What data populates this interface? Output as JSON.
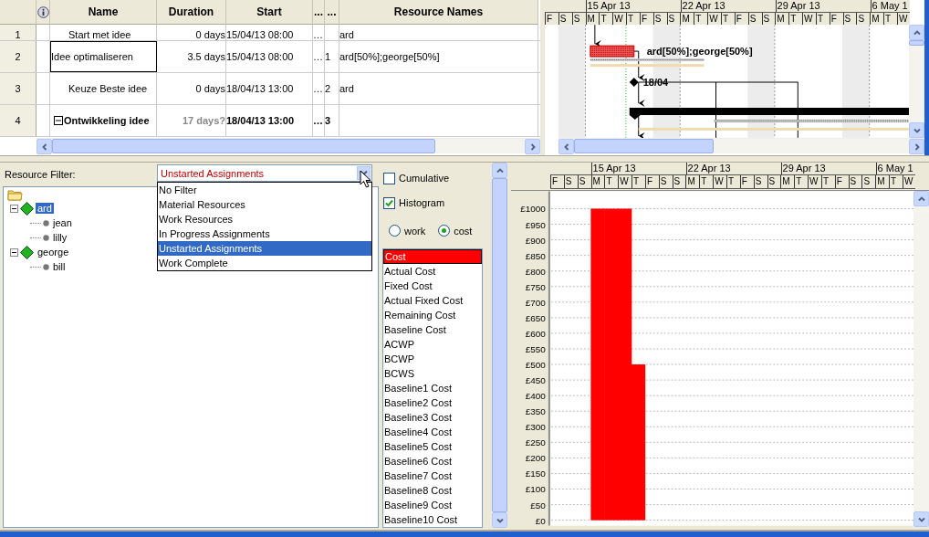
{
  "grid": {
    "columns": [
      "Name",
      "Duration",
      "Start",
      "...",
      "...",
      "Resource Names"
    ],
    "rows": [
      {
        "number": "1",
        "name": "Start met idee",
        "duration": "0 days",
        "start": "15/04/13 08:00",
        "col_5": "…",
        "resources": "ard",
        "kind": "task",
        "selected": false
      },
      {
        "number": "2",
        "name": "Idee optimaliseren",
        "duration": "3.5 days",
        "start": "15/04/13 08:00",
        "col_5": "…",
        "col_6": "1",
        "resources": "ard[50%];george[50%]",
        "kind": "task",
        "selected": true
      },
      {
        "number": "3",
        "name": "Keuze Beste idee",
        "duration": "0 days",
        "start": "18/04/13 13:00",
        "col_5": "…",
        "col_6": "2",
        "resources": "ard",
        "kind": "task",
        "selected": false
      },
      {
        "number": "4",
        "name": "Ontwikkeling idee",
        "duration": "17 days?",
        "start": "18/04/13 13:00",
        "col_5": "…",
        "col_6": "3",
        "kind": "summary",
        "expanded": true,
        "selected": false
      }
    ]
  },
  "gantt": {
    "weeks": [
      "15 Apr 13",
      "22 Apr 13",
      "29 Apr 13",
      "6 May 1"
    ],
    "days": [
      "F",
      "S",
      "S",
      "M",
      "T",
      "W",
      "T",
      "F",
      "S",
      "S",
      "M",
      "T",
      "W",
      "T",
      "F",
      "S",
      "S",
      "M",
      "T",
      "W",
      "T",
      "F",
      "S",
      "S",
      "M",
      "T",
      "W"
    ],
    "bars": [
      {
        "kind": "task",
        "label": "ard[50%];george[50%]"
      },
      {
        "kind": "milestone",
        "label": "18/04"
      },
      {
        "kind": "summary"
      }
    ]
  },
  "resource_filter": {
    "label": "Resource Filter:",
    "value": "Unstarted Assignments",
    "expanded": true,
    "options": [
      {
        "label": "No Filter",
        "selected": false
      },
      {
        "label": "Material Resources",
        "selected": false
      },
      {
        "label": "Work Resources",
        "selected": false
      },
      {
        "label": "In Progress Assignments",
        "selected": false
      },
      {
        "label": "Unstarted Assignments",
        "selected": true
      },
      {
        "label": "Work Complete",
        "selected": false
      }
    ]
  },
  "resource_tree": [
    {
      "label": "ard",
      "selected": true,
      "expanded": true,
      "children": [
        {
          "label": "jean",
          "selected": false
        },
        {
          "label": "lilly",
          "selected": false
        }
      ]
    },
    {
      "label": "george",
      "selected": false,
      "expanded": true,
      "children": [
        {
          "label": "bill",
          "selected": false
        }
      ]
    }
  ],
  "options": {
    "checkboxes": [
      {
        "label": "Cumulative",
        "checked": false
      },
      {
        "label": "Histogram",
        "checked": true
      }
    ],
    "radios": [
      {
        "label": "work",
        "selected": false
      },
      {
        "label": "cost",
        "selected": true
      }
    ],
    "fields": [
      {
        "label": "Cost",
        "selected": true
      },
      {
        "label": "Actual Cost",
        "selected": false
      },
      {
        "label": "Fixed Cost",
        "selected": false
      },
      {
        "label": "Actual Fixed Cost",
        "selected": false
      },
      {
        "label": "Remaining Cost",
        "selected": false
      },
      {
        "label": "Baseline Cost",
        "selected": false
      },
      {
        "label": "ACWP",
        "selected": false
      },
      {
        "label": "BCWP",
        "selected": false
      },
      {
        "label": "BCWS",
        "selected": false
      },
      {
        "label": "Baseline1 Cost",
        "selected": false
      },
      {
        "label": "Baseline2 Cost",
        "selected": false
      },
      {
        "label": "Baseline3 Cost",
        "selected": false
      },
      {
        "label": "Baseline4 Cost",
        "selected": false
      },
      {
        "label": "Baseline5 Cost",
        "selected": false
      },
      {
        "label": "Baseline6 Cost",
        "selected": false
      },
      {
        "label": "Baseline7 Cost",
        "selected": false
      },
      {
        "label": "Baseline8 Cost",
        "selected": false
      },
      {
        "label": "Baseline9 Cost",
        "selected": false
      },
      {
        "label": "Baseline10 Cost",
        "selected": false
      }
    ]
  },
  "histogram": {
    "weeks": [
      "15 Apr 13",
      "22 Apr 13",
      "29 Apr 13",
      "6 May 1"
    ],
    "chart_data": {
      "type": "bar",
      "categories": [
        "F",
        "S",
        "S",
        "M",
        "T",
        "W",
        "T",
        "F",
        "S",
        "S",
        "M",
        "T",
        "W",
        "T",
        "F",
        "S",
        "S",
        "M",
        "T",
        "W",
        "T",
        "F",
        "S",
        "S",
        "M",
        "T",
        "W"
      ],
      "values": [
        0,
        0,
        0,
        1000,
        1000,
        1000,
        500,
        0,
        0,
        0,
        0,
        0,
        0,
        0,
        0,
        0,
        0,
        0,
        0,
        0,
        0,
        0,
        0,
        0,
        0,
        0,
        0
      ],
      "ylim": [
        0,
        1050
      ],
      "grid": true,
      "yticks": [
        {
          "value": 0,
          "label": "£0"
        },
        {
          "value": 50,
          "label": "£50"
        },
        {
          "value": 100,
          "label": "£100"
        },
        {
          "value": 150,
          "label": "£150"
        },
        {
          "value": 200,
          "label": "£200"
        },
        {
          "value": 250,
          "label": "£250"
        },
        {
          "value": 300,
          "label": "£300"
        },
        {
          "value": 350,
          "label": "£350"
        },
        {
          "value": 400,
          "label": "£400"
        },
        {
          "value": 450,
          "label": "£450"
        },
        {
          "value": 500,
          "label": "£500"
        },
        {
          "value": 550,
          "label": "£550"
        },
        {
          "value": 600,
          "label": "£600"
        },
        {
          "value": 650,
          "label": "£650"
        },
        {
          "value": 700,
          "label": "£700"
        },
        {
          "value": 750,
          "label": "£750"
        },
        {
          "value": 800,
          "label": "£800"
        },
        {
          "value": 850,
          "label": "£850"
        },
        {
          "value": 900,
          "label": "£900"
        },
        {
          "value": 950,
          "label": "£950"
        },
        {
          "value": 1000,
          "label": "£1000"
        }
      ]
    }
  }
}
